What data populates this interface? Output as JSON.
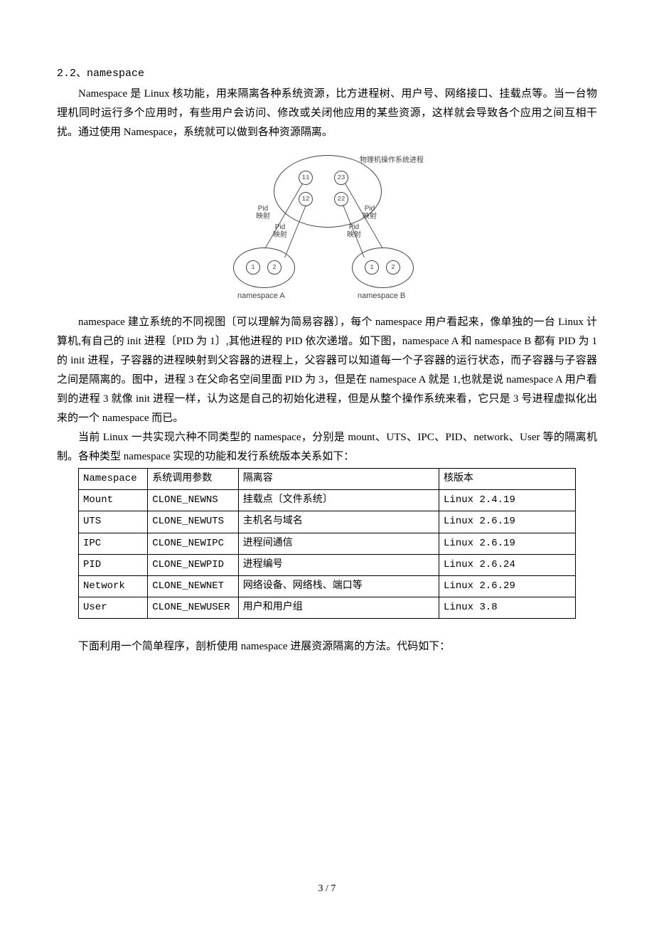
{
  "heading": "2.2、namespace",
  "para1": "Namespace 是 Linux 核功能，用来隔离各种系统资源，比方进程树、用户号、网络接口、挂载点等。当一台物理机同时运行多个应用时，有些用户会访问、修改或关闭他应用的某些资源，这样就会导致各个应用之间互相干扰。通过使用 Namespace，系统就可以做到各种资源隔离。",
  "diagram": {
    "title": "物理机操作系统进程",
    "pid_label": "Pid\n映射",
    "top_nodes": [
      "11",
      "23",
      "12",
      "22"
    ],
    "child_nodes": [
      "1",
      "2"
    ],
    "ns_a": "namespace A",
    "ns_b": "namespace B"
  },
  "para2": "namespace 建立系统的不同视图〔可以理解为简易容器〕，每个 namespace 用户看起来，像单独的一台 Linux 计算机,有自己的 init 进程〔PID 为 1〕,其他进程的 PID 依次递增。如下图，namespace A 和 namespace B 都有 PID 为 1 的 init 进程，子容器的进程映射到父容器的进程上，父容器可以知道每一个子容器的运行状态，而子容器与子容器之间是隔离的。图中，进程 3 在父命名空间里面 PID 为 3，但是在 namespace A 就是 1,也就是说 namespace A 用户看到的进程 3 就像 init 进程一样，认为这是自己的初始化进程，但是从整个操作系统来看，它只是 3 号进程虚拟化出来的一个 namespace 而已。",
  "para3": "当前 Linux 一共实现六种不同类型的 namespace，分别是 mount、UTS、IPC、PID、network、User 等的隔离机制。各种类型 namespace 实现的功能和发行系统版本关系如下：",
  "table": {
    "headers": [
      "Namespace",
      "系统调用参数",
      "隔离容",
      "核版本"
    ],
    "rows": [
      [
        "Mount",
        "CLONE_NEWNS",
        "挂载点〔文件系统〕",
        "Linux 2.4.19"
      ],
      [
        "UTS",
        "CLONE_NEWUTS",
        "主机名与域名",
        "Linux 2.6.19"
      ],
      [
        "IPC",
        "CLONE_NEWIPC",
        "进程间通信",
        "Linux 2.6.19"
      ],
      [
        "PID",
        "CLONE_NEWPID",
        "进程编号",
        "Linux 2.6.24"
      ],
      [
        "Network",
        "CLONE_NEWNET",
        "网络设备、网络栈、端口等",
        "Linux 2.6.29"
      ],
      [
        "User",
        "CLONE_NEWUSER",
        "用户和用户组",
        "Linux 3.8"
      ]
    ]
  },
  "para4": "下面利用一个简单程序，剖析使用 namespace 进展资源隔离的方法。代码如下：",
  "footer": "3 / 7"
}
